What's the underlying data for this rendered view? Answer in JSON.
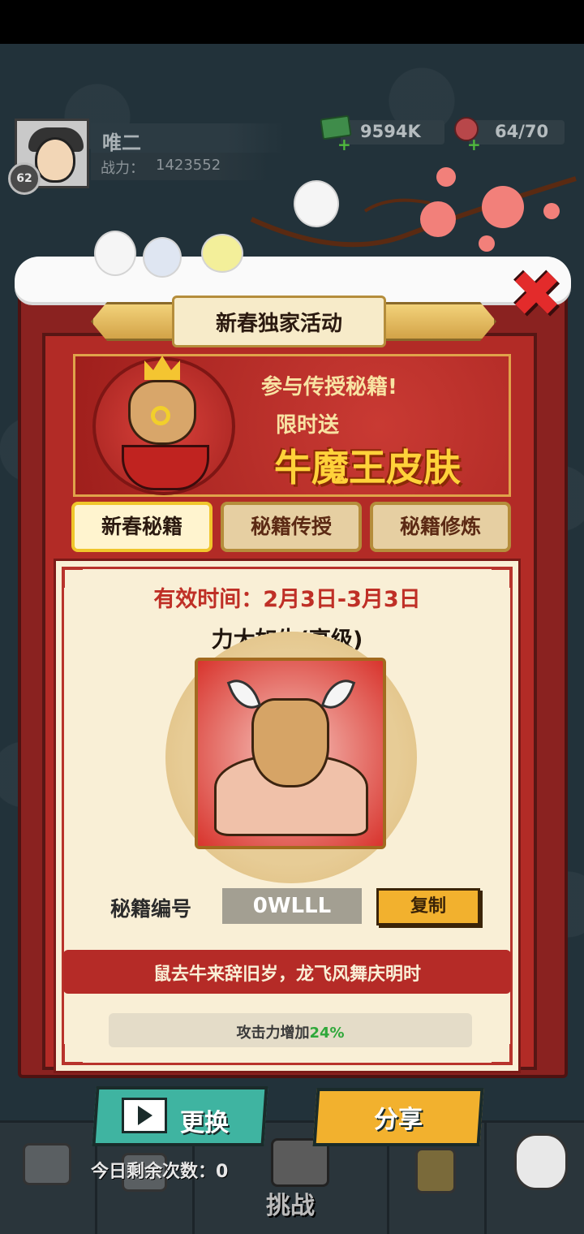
{
  "player": {
    "name": "唯二",
    "level": "62",
    "power_label": "战力：",
    "power_value": "1423552"
  },
  "resources": {
    "cash": "9594K",
    "energy": "64/70"
  },
  "panel": {
    "title": "新春独家活动",
    "close_icon": "close-x-icon"
  },
  "banner": {
    "line1": "参与传授秘籍!",
    "line2": "限时送",
    "line3": "牛魔王皮肤"
  },
  "tabs": [
    {
      "label": "新春秘籍",
      "active": true
    },
    {
      "label": "秘籍传授",
      "active": false
    },
    {
      "label": "秘籍修炼",
      "active": false
    }
  ],
  "content": {
    "valid_time": "有效时间：2月3日-3月3日",
    "skill_name": "力大如牛(高级)",
    "code_label": "秘籍编号",
    "code_value": "0WLLL",
    "copy_label": "复制",
    "motto": "鼠去牛来辞旧岁，龙飞风舞庆明时",
    "effect_label": "攻击力增加",
    "effect_value": "24%"
  },
  "actions": {
    "swap_label": "更换",
    "share_label": "分享"
  },
  "bottom_nav": {
    "remaining_label": "今日剩余次数：0",
    "challenge_label": "挑战"
  },
  "colors": {
    "accent_red": "#b22b26",
    "gold": "#f2b12e",
    "teal": "#3fb4a1",
    "effect_green": "#2fa83a"
  }
}
